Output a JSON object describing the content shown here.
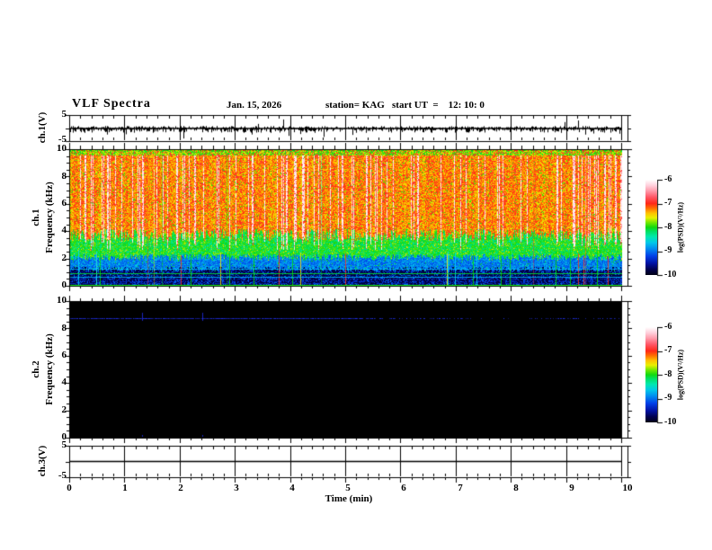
{
  "header": {
    "title": "VLF Spectra",
    "date": "Jan. 15, 2026",
    "station": "station= KAG",
    "start_ut": "start UT  =    12: 10: 0"
  },
  "panels": {
    "ch1_volt": {
      "label": "ch.1(V)",
      "yticks": [
        "5",
        "-5"
      ]
    },
    "ch1_spec": {
      "label_channel": "ch.1",
      "label_axis": "Frequency (kHz)",
      "yticks": [
        "10",
        "8",
        "6",
        "4",
        "2",
        "0"
      ]
    },
    "ch2_spec": {
      "label_channel": "ch.2",
      "label_axis": "Frequency (kHz)",
      "yticks": [
        "10",
        "8",
        "6",
        "4",
        "2",
        "0"
      ]
    },
    "ch3_volt": {
      "label": "ch.3(V)",
      "yticks": [
        "5",
        "-5"
      ]
    }
  },
  "xaxis": {
    "label": "Time (min)",
    "ticks": [
      "0",
      "1",
      "2",
      "3",
      "4",
      "5",
      "6",
      "7",
      "8",
      "9",
      "10"
    ],
    "range_min": [
      0,
      10
    ],
    "minor_step_min": 0.2
  },
  "colorbars": [
    {
      "label": "log(PSD)(V²/Hz)",
      "ticks": [
        "-6",
        "-7",
        "-8",
        "-9",
        "-10"
      ],
      "range": [
        -10,
        -6
      ]
    },
    {
      "label": "log(PSD)(V²/Hz)",
      "ticks": [
        "-6",
        "-7",
        "-8",
        "-9",
        "-10"
      ],
      "range": [
        -10,
        -6
      ]
    }
  ],
  "palette_stops": [
    {
      "p": 0.0,
      "c": "#000014"
    },
    {
      "p": 0.06,
      "c": "#000050"
    },
    {
      "p": 0.12,
      "c": "#0010a0"
    },
    {
      "p": 0.2,
      "c": "#0040e8"
    },
    {
      "p": 0.28,
      "c": "#0090f0"
    },
    {
      "p": 0.34,
      "c": "#00c8e8"
    },
    {
      "p": 0.4,
      "c": "#00e8b0"
    },
    {
      "p": 0.46,
      "c": "#00e060"
    },
    {
      "p": 0.5,
      "c": "#10d810"
    },
    {
      "p": 0.55,
      "c": "#70e800"
    },
    {
      "p": 0.6,
      "c": "#e8f000"
    },
    {
      "p": 0.65,
      "c": "#ffc000"
    },
    {
      "p": 0.7,
      "c": "#ff7000"
    },
    {
      "p": 0.75,
      "c": "#ff2818"
    },
    {
      "p": 0.82,
      "c": "#ff5868"
    },
    {
      "p": 0.88,
      "c": "#ff98a8"
    },
    {
      "p": 0.94,
      "c": "#ffd0dc"
    },
    {
      "p": 1.0,
      "c": "#ffffff"
    }
  ],
  "chart_data": [
    {
      "type": "line",
      "id": "ch1_waveform",
      "ylabel": "ch.1(V)",
      "ylim": [
        -5,
        5
      ],
      "xlim_min": [
        0,
        10
      ],
      "baseline_v": 0,
      "noise_v_up": 0.8,
      "noise_v_down": 1.6,
      "data_end_min": 9.9,
      "spikes": [
        {
          "t_min": 2.06,
          "v": -4.0
        },
        {
          "t_min": 3.4,
          "v": 1.6
        },
        {
          "t_min": 3.86,
          "v": 3.3
        },
        {
          "t_min": 3.96,
          "v": -3.0
        },
        {
          "t_min": 4.6,
          "v": -3.4
        },
        {
          "t_min": 6.55,
          "v": -1.8
        },
        {
          "t_min": 8.95,
          "v": 2.3
        },
        {
          "t_min": 9.2,
          "v": 2.9
        }
      ]
    },
    {
      "type": "heatmap",
      "id": "ch1_spectrogram",
      "ylabel": "ch.1 Frequency (kHz)",
      "ylim_khz": [
        0,
        10
      ],
      "xlim_min": [
        0,
        10
      ],
      "data_end_min": 9.9,
      "zlabel": "log(PSD)(V²/Hz)",
      "zlim": [
        -10,
        -6
      ],
      "description": "Dense broadband VLF activity: red/white saturated vertical streaks 3.6-10 kHz, green band 2-3.6 kHz, blue speckle 1.2-2 kHz, near-black below 1.2 kHz crossed by thin vertical sferic lines",
      "top_band_khz": 9.6,
      "band_boundaries_khz": [
        3.6,
        1.9,
        1.1
      ],
      "hlines": [
        {
          "f_khz": 1.25,
          "color": "#00c8ff",
          "alpha": 0.75
        },
        {
          "f_khz": 0.92,
          "color": "#00dd33",
          "alpha": 0.9
        },
        {
          "f_khz": 0.66,
          "color": "#00c8ff",
          "alpha": 0.8
        },
        {
          "f_khz": 0.05,
          "color": "#22ff22",
          "alpha": 1.0
        }
      ],
      "dotted_rows_khz": [
        0.5,
        0.33,
        0.18
      ],
      "vline_count": 26,
      "full_height_vline_count": 7
    },
    {
      "type": "heatmap",
      "id": "ch2_spectrogram",
      "ylabel": "ch.2 Frequency (kHz)",
      "ylim_khz": [
        0,
        10
      ],
      "xlim_min": [
        0,
        10
      ],
      "data_end_min": 9.9,
      "zlabel": "log(PSD)(V²/Hz)",
      "zlim": [
        -10,
        -6
      ],
      "description": "No signal (background at -10, black) except faint narrowband blue line near 8.8 kHz, solid until ~5.3 min then intermittent",
      "hline": {
        "f_khz": 8.8,
        "color": "#2030f0",
        "solid_until_min": 5.3
      },
      "marks_t_min": [
        1.3,
        2.4
      ]
    },
    {
      "type": "line",
      "id": "ch3_waveform",
      "ylabel": "ch.3(V)",
      "ylim": [
        -5,
        5
      ],
      "xlim_min": [
        0,
        10
      ],
      "flat_value_v": 0,
      "data_end_min": 9.9
    }
  ]
}
